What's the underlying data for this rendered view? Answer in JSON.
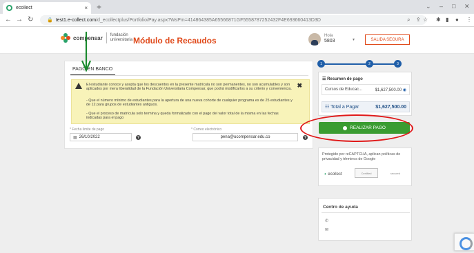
{
  "browser": {
    "tab_title": "ecollect",
    "tab_close": "×",
    "new_tab": "+",
    "url_host": "test1.e-collect.com",
    "url_path": "/d_ecollectplus/Portfolio/Pay.aspx?WsPm=414864385A65566871GF5558787252432F4E693660413D3D"
  },
  "header": {
    "brand": "compensar",
    "university": "fundación universitaria",
    "app_title": "Módulo de Recaudos",
    "user_label": "Hola",
    "user_id": "5803",
    "logout": "SALIDA SEGURA"
  },
  "payment": {
    "tab_label": "PAGO EN BANCO",
    "notice": [
      "El estudiante conoce y acepta que los descuentos en la presente matrícula no son permanentes, no son acumulables y son aplicados por mera liberalidad de la Fundación Universitaria Compensar, que podrá modificarlos a su criterio y conveniencia.",
      "- Que el número mínimo de estudiantes para la apertura de una nueva cohorte de cualquier programa es de 25 estudiantes y de 12 para grupos de estudiantes antiguos.",
      "- Que el proceso de matrícula solo termina y queda formalizado con el pago del valor total de la misma en las fechas indicadas para el pago"
    ],
    "date_label": "* Fecha límite de pago",
    "date_value": "26/10/2022",
    "email_label": "* Correo electrónico",
    "email_value": "pena@ucompensar.edu.co"
  },
  "steps": [
    "1",
    "2",
    "3"
  ],
  "summary": {
    "title": "Resumen de pago",
    "item_label": "Cursos de Educac...",
    "item_amount": "$1,627,500.00",
    "total_label": "Total a Pagar",
    "total_amount": "$1,627,500.00"
  },
  "pay_button": "REALIZAR PAGO",
  "captcha": {
    "text": "Protegido por reCAPTCHA, aplican políticas de privacidad y términos de Google",
    "brand": "ecollect",
    "badge1": "Certified",
    "badge2": "secured"
  },
  "help": {
    "title": "Centro de ayuda",
    "phone_icon": "phone-icon",
    "mail_icon": "mail-icon"
  },
  "colors": {
    "brand_orange": "#e04a1b",
    "step_blue": "#1f5ea8",
    "pay_green": "#3a9c31",
    "annotation_red": "#e01818",
    "annotation_green": "#1a8a2e"
  }
}
